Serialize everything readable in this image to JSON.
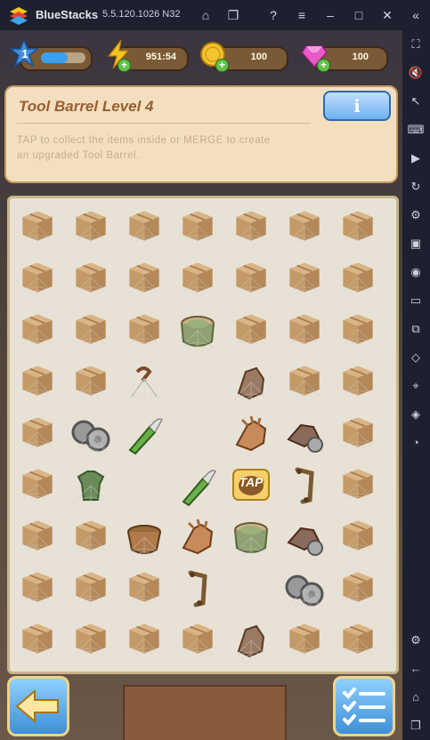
{
  "titlebar": {
    "app_name": "BlueStacks",
    "version": "5.5.120.1026 N32"
  },
  "sidebar_icons": [
    "fullscreen-icon",
    "volume-icon",
    "cursor-icon",
    "keyboard-icon",
    "play-icon",
    "rotate-icon",
    "gamepad-icon",
    "apk-icon",
    "screenshot-icon",
    "folder-icon",
    "multi-instance-icon",
    "eraser-icon",
    "location-icon",
    "layers-icon",
    "speed-icon",
    "settings-icon",
    "back-icon",
    "home-icon",
    "recent-icon"
  ],
  "resources": {
    "level": "1",
    "level_progress": 0.6,
    "energy": "951:54",
    "coins": "100",
    "gems": "100"
  },
  "info_panel": {
    "title": "Tool Barrel Level 4",
    "description": "TAP to collect the items inside or MERGE to create an upgraded Tool Barrel.",
    "info_button": "i"
  },
  "board": {
    "rows": [
      [
        "box",
        "box",
        "box",
        "box",
        "box",
        "box",
        "box"
      ],
      [
        "box",
        "box",
        "box",
        "box",
        "box",
        "box",
        "box"
      ],
      [
        "box",
        "box",
        "box",
        "barrel",
        "box",
        "box",
        "box"
      ],
      [
        "box",
        "box",
        "wire",
        "empty",
        "glove-web",
        "box",
        "box"
      ],
      [
        "box",
        "wheels",
        "cutter",
        "empty",
        "glove",
        "glove-wheel",
        "box"
      ],
      [
        "box",
        "shirt",
        "empty",
        "cutter",
        "tap-barrel",
        "handle",
        "box"
      ],
      [
        "box",
        "box",
        "basket",
        "glove",
        "barrel",
        "glove-wheel",
        "box"
      ],
      [
        "box",
        "box",
        "box",
        "handle",
        "empty",
        "wheels",
        "box"
      ],
      [
        "box",
        "box",
        "box",
        "box",
        "glove-web",
        "box",
        "box"
      ]
    ],
    "tap_label": "TAP"
  },
  "colors": {
    "accent": "#3f8fd8",
    "panel": "#f3dfc0",
    "title": "#9a5e2e"
  }
}
